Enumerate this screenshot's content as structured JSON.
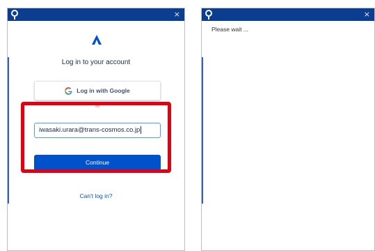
{
  "login_window": {
    "close_glyph": "×",
    "title": "Log in to your account",
    "google_button_label": "Log in with Google",
    "email_value": "iwasaki.urara@trans-cosmos.co.jp",
    "continue_label": "Continue",
    "cant_login_label": "Can't log in?"
  },
  "wait_window": {
    "close_glyph": "×",
    "message": "Please wait ..."
  },
  "colors": {
    "titlebar": "#0b3d91",
    "primary_button": "#0052cc",
    "highlight_box": "#e30010",
    "link": "#0052cc"
  },
  "icons": {
    "titlebar_app": "pin-logo-icon",
    "brand": "atlassian-logo-icon",
    "google": "google-g-icon",
    "close": "close-icon"
  }
}
